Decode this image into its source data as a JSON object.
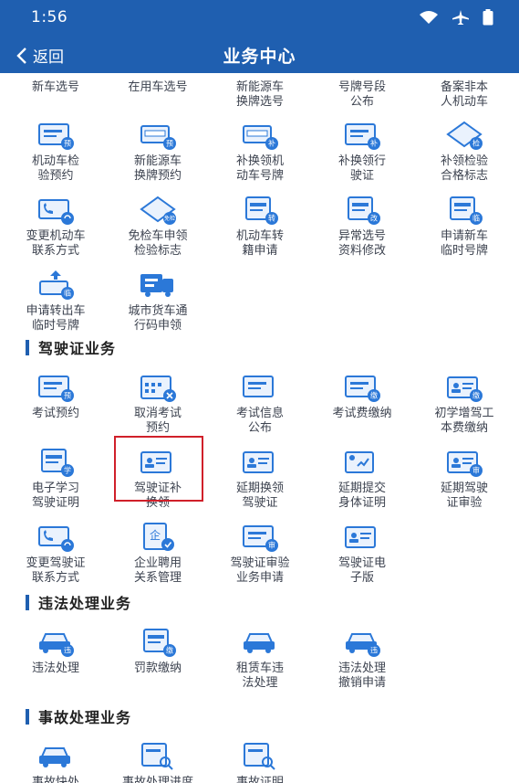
{
  "status": {
    "time": "1:56"
  },
  "nav": {
    "back_label": "返回",
    "title": "业务中心"
  },
  "top_partial": [
    {
      "name": "new-car-plate",
      "line1": "新车选号",
      "line2": ""
    },
    {
      "name": "used-car-plate",
      "line1": "在用车选号",
      "line2": ""
    },
    {
      "name": "new-energy-plate",
      "line1": "新能源车",
      "line2": "换牌选号"
    },
    {
      "name": "plate-segment",
      "line1": "号牌号段",
      "line2": "公布"
    },
    {
      "name": "non-owner-vehicle",
      "line1": "备案非本",
      "line2": "人机动车"
    }
  ],
  "vehicle_items": [
    {
      "name": "vehicle-inspection-appointment",
      "line1": "机动车检",
      "line2": "验预约",
      "icon": "card-badge",
      "badge": "预"
    },
    {
      "name": "new-energy-plate-appointment",
      "line1": "新能源车",
      "line2": "换牌预约",
      "icon": "plate-badge",
      "badge": "预"
    },
    {
      "name": "replace-plate",
      "line1": "补换领机",
      "line2": "动车号牌",
      "icon": "plate-badge",
      "badge": "补"
    },
    {
      "name": "replace-license",
      "line1": "补换领行",
      "line2": "驶证",
      "icon": "card-badge",
      "badge": "补"
    },
    {
      "name": "inspection-sticker",
      "line1": "补领检验",
      "line2": "合格标志",
      "icon": "diamond-badge",
      "badge": "检"
    },
    {
      "name": "change-contact",
      "line1": "变更机动车",
      "line2": "联系方式",
      "icon": "phone-card",
      "badge": ""
    },
    {
      "name": "exempt-inspection",
      "line1": "免检车申领",
      "line2": "检验标志",
      "icon": "diamond",
      "badge": "免检"
    },
    {
      "name": "vehicle-transfer",
      "line1": "机动车转",
      "line2": "籍申请",
      "icon": "doc-badge",
      "badge": "转"
    },
    {
      "name": "plate-info-fix",
      "line1": "异常选号",
      "line2": "资料修改",
      "icon": "doc-badge",
      "badge": "改"
    },
    {
      "name": "temporary-plate",
      "line1": "申请新车",
      "line2": "临时号牌",
      "icon": "doc-badge",
      "badge": "临"
    },
    {
      "name": "transfer-temp-plate",
      "line1": "申请转出车",
      "line2": "临时号牌",
      "icon": "upload-badge",
      "badge": "临"
    },
    {
      "name": "truck-pass",
      "line1": "城市货车通",
      "line2": "行码申领",
      "icon": "truck",
      "badge": ""
    }
  ],
  "sections": {
    "driver": "驾驶证业务",
    "violation": "违法处理业务",
    "accident": "事故处理业务"
  },
  "driver_items": [
    {
      "name": "exam-appointment",
      "line1": "考试预约",
      "line2": "",
      "icon": "card-badge",
      "badge": "预"
    },
    {
      "name": "cancel-exam",
      "line1": "取消考试",
      "line2": "预约",
      "icon": "calendar-x",
      "badge": ""
    },
    {
      "name": "exam-info",
      "line1": "考试信息",
      "line2": "公布",
      "icon": "card-badge",
      "badge": ""
    },
    {
      "name": "exam-fee",
      "line1": "考试费缴纳",
      "line2": "",
      "icon": "card-badge",
      "badge": "缴"
    },
    {
      "name": "learner-fee",
      "line1": "初学增驾工",
      "line2": "本费缴纳",
      "icon": "id-badge",
      "badge": "缴"
    },
    {
      "name": "e-study-cert",
      "line1": "电子学习",
      "line2": "驾驶证明",
      "icon": "doc-学",
      "badge": "学"
    },
    {
      "name": "replace-driver-license",
      "line1": "驾驶证补",
      "line2": "换领",
      "icon": "id-stack",
      "badge": ""
    },
    {
      "name": "delay-renewal",
      "line1": "延期换领",
      "line2": "驾驶证",
      "icon": "id-badge",
      "badge": ""
    },
    {
      "name": "delay-health-cert",
      "line1": "延期提交",
      "line2": "身体证明",
      "icon": "health",
      "badge": ""
    },
    {
      "name": "delay-license-review",
      "line1": "延期驾驶",
      "line2": "证审验",
      "icon": "id-stack",
      "badge": "审"
    },
    {
      "name": "change-driver-contact",
      "line1": "变更驾驶证",
      "line2": "联系方式",
      "icon": "phone-card",
      "badge": ""
    },
    {
      "name": "company-hiring",
      "line1": "企业聘用",
      "line2": "关系管理",
      "icon": "company",
      "badge": "企"
    },
    {
      "name": "license-review",
      "line1": "驾驶证审验",
      "line2": "业务申请",
      "icon": "card-badge",
      "badge": "审"
    },
    {
      "name": "e-license",
      "line1": "驾驶证电",
      "line2": "子版",
      "icon": "id-badge",
      "badge": ""
    }
  ],
  "violation_items": [
    {
      "name": "violation-handle",
      "line1": "违法处理",
      "line2": "",
      "icon": "car-badge",
      "badge": "违"
    },
    {
      "name": "fine-payment",
      "line1": "罚款缴纳",
      "line2": "",
      "icon": "doc-badge",
      "badge": "缴"
    },
    {
      "name": "rental-violation",
      "line1": "租赁车违",
      "line2": "法处理",
      "icon": "car-stack",
      "badge": ""
    },
    {
      "name": "violation-revoke",
      "line1": "违法处理",
      "line2": "撤销申请",
      "icon": "car-badge",
      "badge": "违"
    }
  ],
  "accident_items": [
    {
      "name": "accident-quick",
      "line1": "事故快处",
      "line2": "",
      "icon": "car-card",
      "badge": ""
    },
    {
      "name": "accident-progress",
      "line1": "事故处理进度",
      "line2": "",
      "icon": "search-card",
      "badge": ""
    },
    {
      "name": "accident-cert",
      "line1": "事故证明",
      "line2": "",
      "icon": "doc-search",
      "badge": ""
    }
  ],
  "colors": {
    "primary": "#1f5fb0",
    "icon_blue": "#2b78d8",
    "highlight": "#d0202a"
  }
}
